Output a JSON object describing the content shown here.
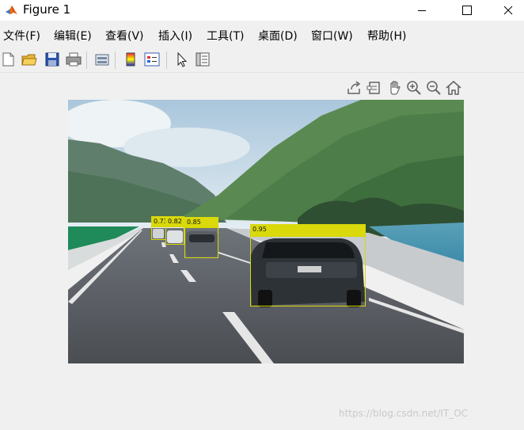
{
  "window": {
    "title": "Figure 1"
  },
  "menu": [
    {
      "label": "文件(F)"
    },
    {
      "label": "编辑(E)"
    },
    {
      "label": "查看(V)"
    },
    {
      "label": "插入(I)"
    },
    {
      "label": "工具(T)"
    },
    {
      "label": "桌面(D)"
    },
    {
      "label": "窗口(W)"
    },
    {
      "label": "帮助(H)"
    }
  ],
  "toolbar": {
    "icons": [
      "new-figure-icon",
      "open-file-icon",
      "save-icon",
      "print-icon",
      "link-plot-icon",
      "insert-colorbar-icon",
      "insert-legend-icon",
      "edit-plot-icon",
      "property-inspector-icon"
    ]
  },
  "axes_toolbar": {
    "icons": [
      "export-icon",
      "brush-icon",
      "pan-icon",
      "zoom-in-icon",
      "zoom-out-icon",
      "home-icon"
    ]
  },
  "detections": [
    {
      "label": "0.73",
      "score": 0.73
    },
    {
      "label": "0.82",
      "score": 0.82
    },
    {
      "label": "0.85",
      "score": 0.85
    },
    {
      "label": "0.95",
      "score": 0.95
    }
  ],
  "colors": {
    "box": "#d8d800",
    "label_bg": "#d9d90c"
  },
  "watermark": "https://blog.csdn.net/IT_OC"
}
